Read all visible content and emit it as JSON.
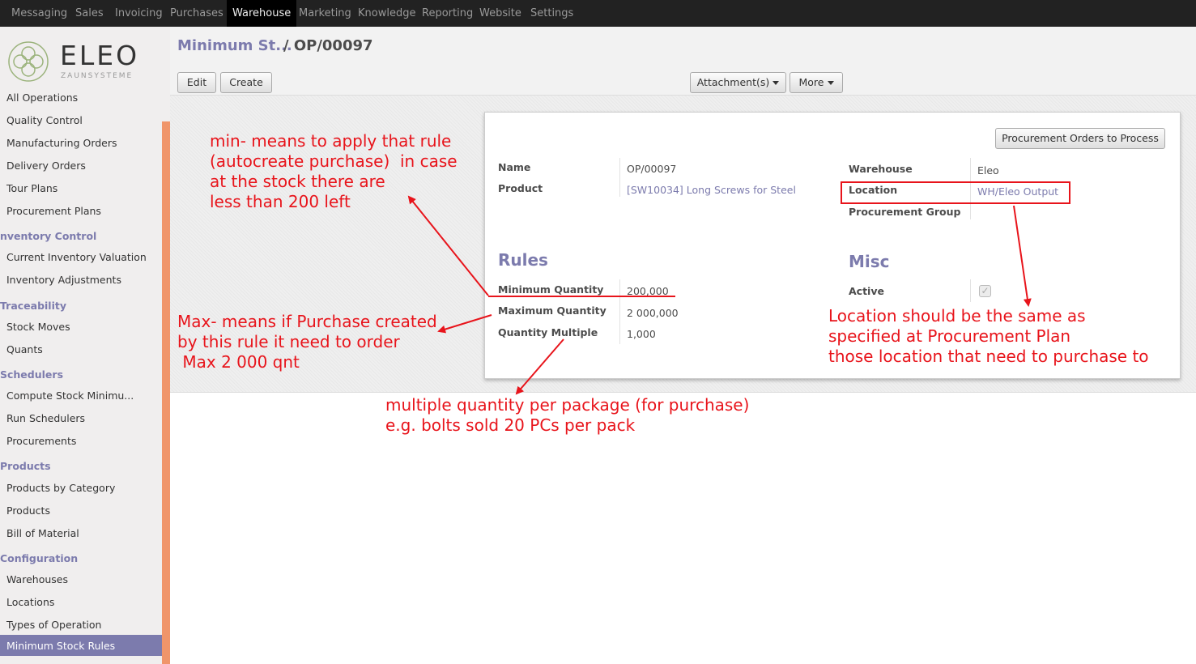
{
  "topbar": {
    "menus": [
      "Messaging",
      "Sales",
      "Invoicing",
      "Purchases",
      "Warehouse",
      "Marketing",
      "Knowledge",
      "Reporting",
      "Website",
      "Settings"
    ]
  },
  "logo": {
    "name": "ELEO",
    "subtitle": "ZAUNSYSTEME"
  },
  "sidebar": {
    "items": [
      "All Operations",
      "Quality Control",
      "Manufacturing Orders",
      "Delivery Orders",
      "Tour Plans",
      "Procurement Plans",
      "Current Inventory Valuation",
      "Inventory Adjustments",
      "Stock Moves",
      "Quants",
      "Compute Stock Minimu...",
      "Run Schedulers",
      "Procurements",
      "Products by Category",
      "Products",
      "Bill of Material",
      "Warehouses",
      "Locations",
      "Types of Operation"
    ],
    "sections": [
      "nventory Control",
      "Traceability",
      "Schedulers",
      "Products",
      "Configuration"
    ],
    "active": "Minimum Stock Rules"
  },
  "breadcrumb": {
    "parent": "Minimum St...",
    "current": "/ OP/00097"
  },
  "toolbar": {
    "edit": "Edit",
    "create": "Create",
    "attachments": "Attachment(s)",
    "more": "More"
  },
  "form": {
    "button": "Procurement Orders to Process",
    "name_label": "Name",
    "name_value": "OP/00097",
    "product_label": "Product",
    "product_value": "[SW10034] Long Screws for Steel",
    "warehouse_label": "Warehouse",
    "warehouse_value": "Eleo",
    "location_label": "Location",
    "location_value": "WH/Eleo Output",
    "group_label": "Procurement Group",
    "rules_title": "Rules",
    "min_label": "Minimum Quantity",
    "min_value": "200,000",
    "max_label": "Maximum Quantity",
    "max_value": "2 000,000",
    "multiple_label": "Quantity Multiple",
    "multiple_value": "1,000",
    "misc_title": "Misc",
    "active_label": "Active",
    "active_checked": true
  },
  "annotations": {
    "min_note": "min- means to apply that rule\n(autocreate purchase)  in case\nat the stock there are\nless than 200 left",
    "max_note": "Max- means if Purchase created\nby this rule it need to order\n Max 2 000 qnt",
    "multiple_note": "multiple quantity per package (for purchase)\ne.g. bolts sold 20 PCs per pack",
    "location_note": "Location should be the same as\nspecified at Procurement Plan\nthose location that need to purchase to",
    "annotation_color": "#e8141b"
  },
  "colors": {
    "accent": "#7c7bad",
    "sidebar_strip": "#f0956a",
    "topbar": "#222222"
  }
}
